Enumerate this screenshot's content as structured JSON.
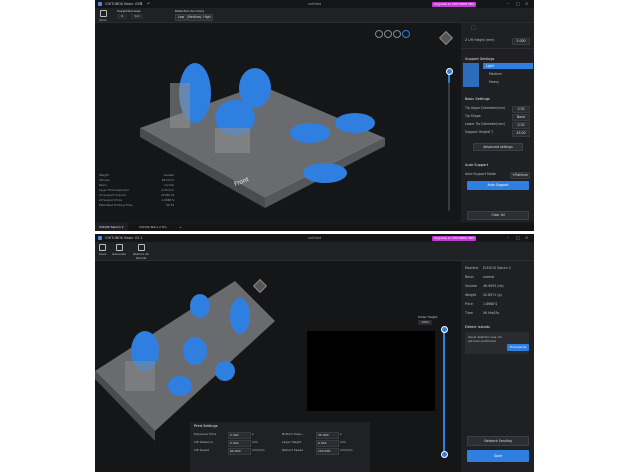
{
  "top": {
    "app_name": "CHITUBOX Basic V2.1",
    "title": "untitled",
    "upgrade_label": "Upgrade to CHITUBOX PRO",
    "toolbar": {
      "open": "Open",
      "supported_area_label": "Supported Area",
      "x_val": "0",
      "y_val": "0.0",
      "detection_label": "Detection Accuracy",
      "det_low": "Low",
      "det_med": "Medium",
      "det_high": "High"
    },
    "sidebar": {
      "top_label": "Z Lift Height (mm)",
      "top_val": "5.000",
      "support_settings": "Support Settings",
      "light": "Light",
      "medium": "Medium",
      "heavy": "Heavy",
      "basic_settings": "Basic Settings",
      "rows": [
        {
          "label": "Tip Upper Diameter(mm)",
          "val": "0.30"
        },
        {
          "label": "Tip Shape",
          "val": "None"
        },
        {
          "label": "Lower Tip Diameter(mm)",
          "val": "0.30"
        },
        {
          "label": "Support Height(°)",
          "val": "45.00"
        }
      ],
      "advanced": "Advanced settings",
      "auto_support": "Auto Support",
      "auto_mode_label": "Auto Support Mode",
      "auto_mode_val": "+Platform",
      "auto_support_btn": "Auto Support",
      "clear_all": "Clear All"
    },
    "stats": [
      {
        "k": "Weight",
        "v": "Loaded"
      },
      {
        "k": "Volume",
        "v": "39.23 ml"
      },
      {
        "k": "Resin",
        "v": "normal"
      },
      {
        "k": "Layer Thickness(mm)",
        "v": "0.05 mm"
      },
      {
        "k": "All Support Volume",
        "v": "24336 Ct"
      },
      {
        "k": "All Support Price",
        "v": "1.0668 $"
      },
      {
        "k": "Estimated Printing Time",
        "v": "02:33"
      }
    ],
    "plate_label": "Front",
    "tabs": [
      "CUDOX Saturn 2",
      "CUDOX Mars 2 Pro"
    ]
  },
  "bottom": {
    "app_name": "CHITUBOX Basic V2.1",
    "title": "untitled",
    "upgrade_label": "Upgrade to CHITUBOX PRO",
    "toolbar": {
      "save": "Save",
      "generate": "Generate",
      "restore": "Restore All Islands"
    },
    "slider_top_label": "Slider Height",
    "slider_top_val": "1084",
    "print_settings": {
      "title": "Print Settings",
      "left": [
        {
          "label": "Exposure Time",
          "val": "2.300",
          "unit": "s"
        },
        {
          "label": "Lift Distance",
          "val": "5.000",
          "unit": "mm"
        },
        {
          "label": "Lift Speed",
          "val": "60.000",
          "unit": "mm/min"
        }
      ],
      "right": [
        {
          "label": "Bottom Expo...",
          "val": "35.000",
          "unit": "s"
        },
        {
          "label": "Layer Height",
          "val": "0.050",
          "unit": "mm"
        },
        {
          "label": "Retract Speed",
          "val": "150.000",
          "unit": "mm/min"
        }
      ]
    },
    "info": [
      {
        "k": "Machine",
        "v": "ELEGOO Saturn 2"
      },
      {
        "k": "Resin",
        "v": "normal"
      },
      {
        "k": "Volume",
        "v": "46.9093 (ml)"
      },
      {
        "k": "Weight",
        "v": "52.8971 (g)"
      },
      {
        "k": "Price",
        "v": "1.8668 $"
      },
      {
        "k": "Time",
        "v": "06 Hrs05s"
      }
    ],
    "detect_title": "Detect islands",
    "detect_text": "Island detection has not yet been performed",
    "detect_btn": "Find Islands",
    "network_btn": "Network Sending",
    "save_btn": "Save"
  }
}
